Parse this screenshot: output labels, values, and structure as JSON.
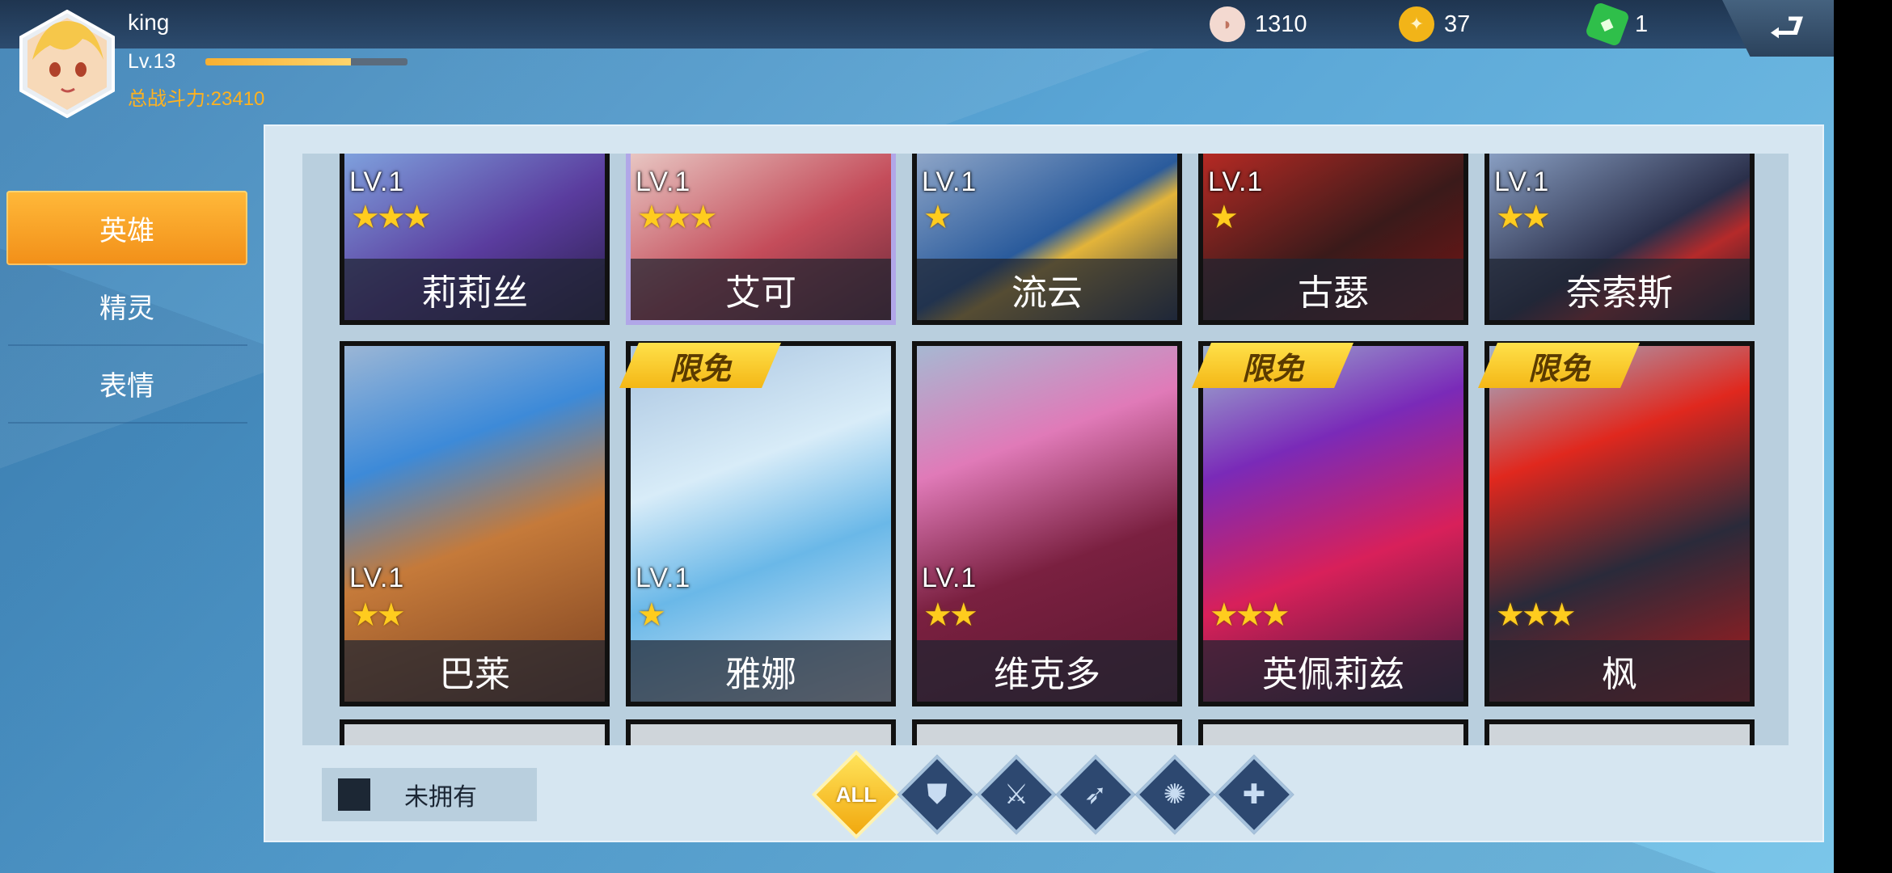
{
  "player": {
    "name": "king",
    "level": "Lv.13",
    "xp_fraction": 0.72,
    "power": "总战斗力:23410"
  },
  "resources": [
    {
      "icon": "shell-icon",
      "value": "1310"
    },
    {
      "icon": "gold-coin-icon",
      "value": "37"
    },
    {
      "icon": "green-gem-icon",
      "value": "1"
    }
  ],
  "sidebar": {
    "items": [
      {
        "label": "英雄",
        "active": true
      },
      {
        "label": "精灵",
        "active": false
      },
      {
        "label": "表情",
        "active": false
      }
    ]
  },
  "heroes_row1": [
    {
      "name": "莉莉丝",
      "level": "LV.1",
      "stars": "★★★"
    },
    {
      "name": "艾可",
      "level": "LV.1",
      "stars": "★★★"
    },
    {
      "name": "流云",
      "level": "LV.1",
      "stars": "★"
    },
    {
      "name": "古瑟",
      "level": "LV.1",
      "stars": "★"
    },
    {
      "name": "奈索斯",
      "level": "LV.1",
      "stars": "★★"
    }
  ],
  "heroes_row2": [
    {
      "name": "巴莱",
      "level": "LV.1",
      "stars": "★★",
      "badge": ""
    },
    {
      "name": "雅娜",
      "level": "LV.1",
      "stars": "★",
      "badge": "限免"
    },
    {
      "name": "维克多",
      "level": "LV.1",
      "stars": "★★",
      "badge": ""
    },
    {
      "name": "英佩莉兹",
      "level": "",
      "stars": "★★★",
      "badge": "限免"
    },
    {
      "name": "枫",
      "level": "",
      "stars": "★★★",
      "badge": "限免"
    }
  ],
  "filters": {
    "unowned_label": "未拥有",
    "classes": [
      {
        "label": "ALL",
        "icon": "all-icon",
        "active": true
      },
      {
        "label": "",
        "icon": "shield-class-icon",
        "active": false
      },
      {
        "label": "",
        "icon": "sword-class-icon",
        "active": false
      },
      {
        "label": "",
        "icon": "bow-class-icon",
        "active": false
      },
      {
        "label": "",
        "icon": "magic-class-icon",
        "active": false
      },
      {
        "label": "",
        "icon": "healer-class-icon",
        "active": false
      }
    ]
  },
  "colors": {
    "accent": "#f7a41e",
    "power_text": "#ffb21f",
    "badge": "#f4c21f"
  }
}
